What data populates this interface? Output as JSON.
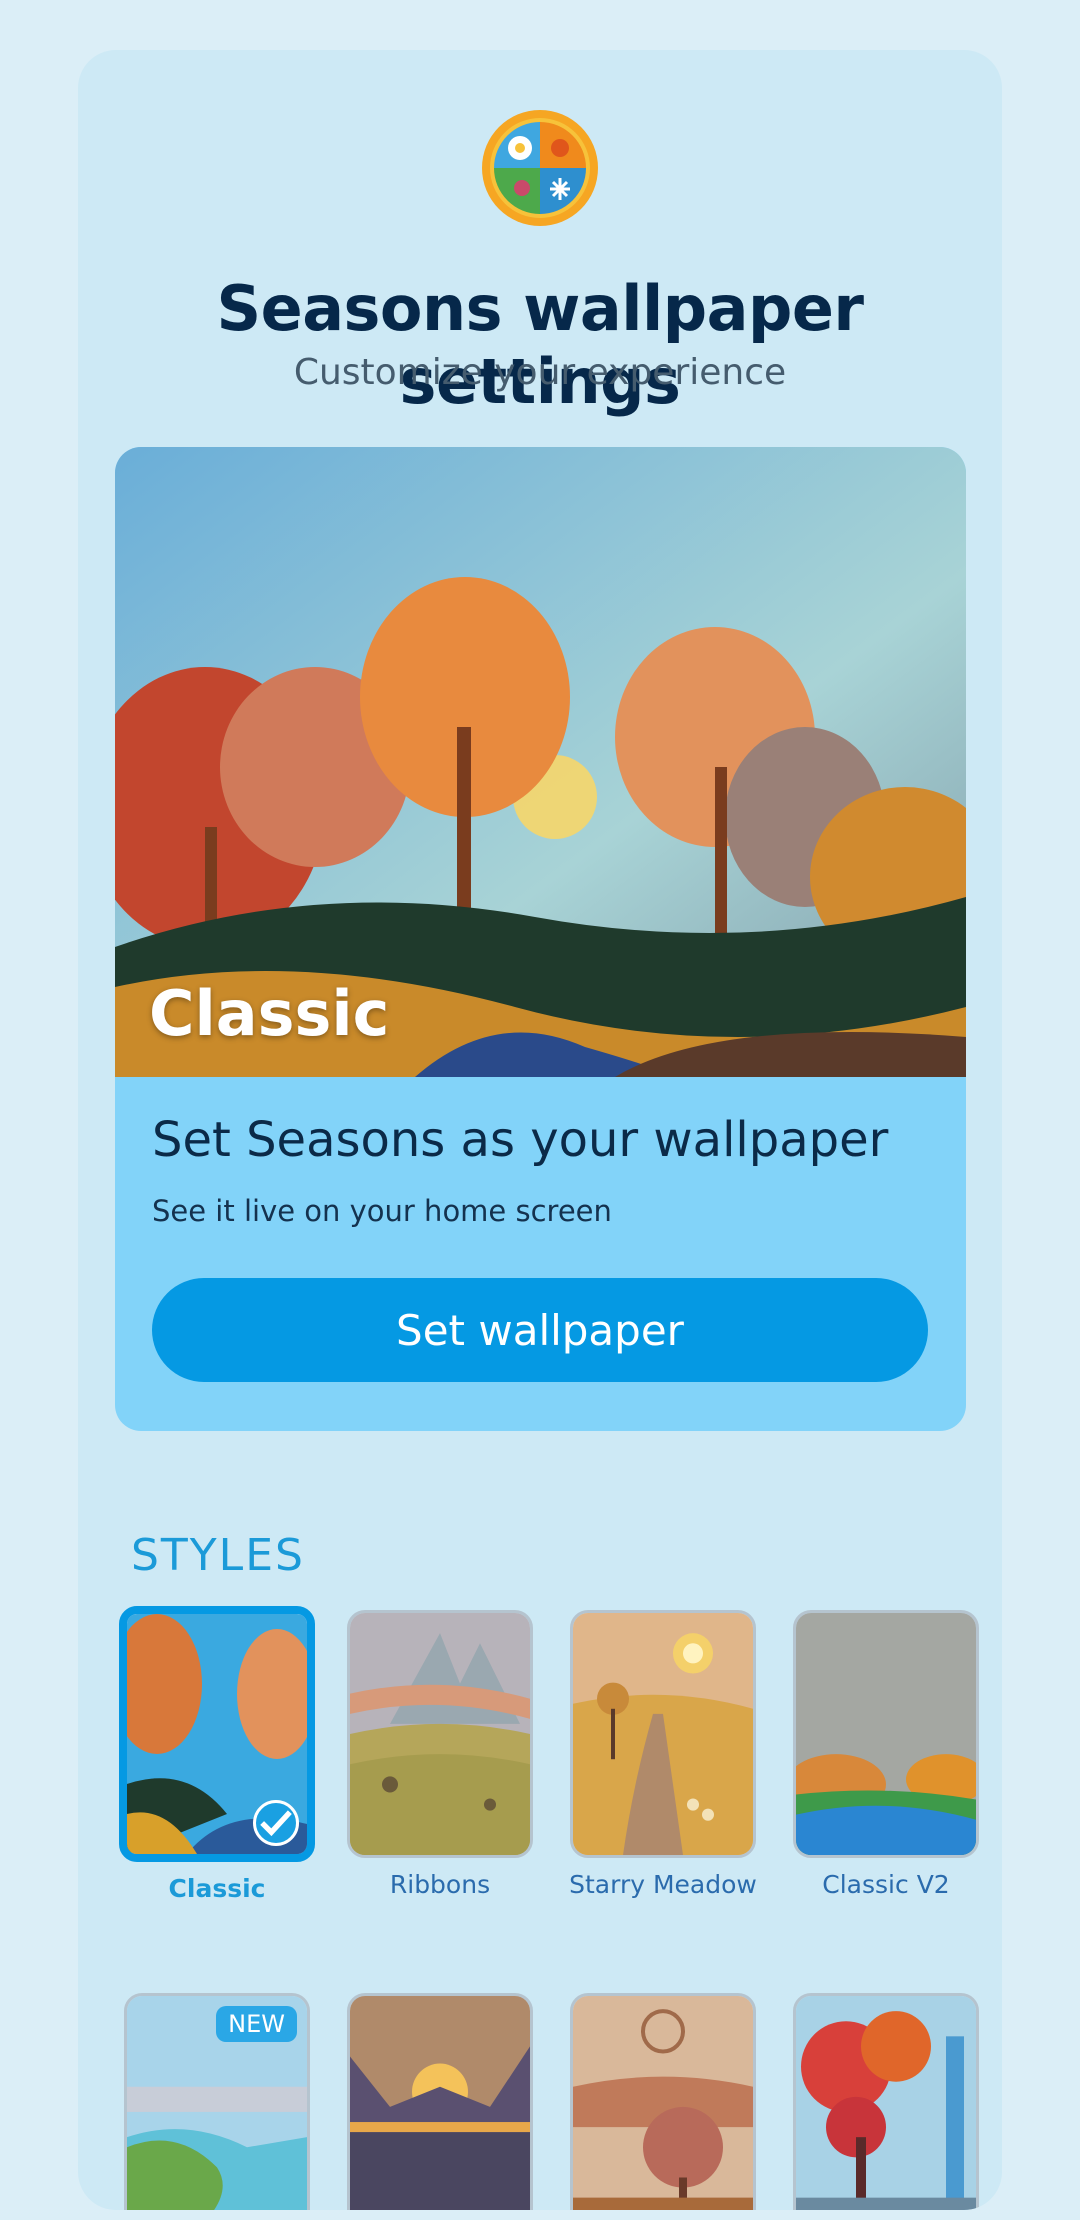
{
  "header": {
    "title": "Seasons wallpaper settings",
    "subtitle": "Customize your experience",
    "logo": "four-seasons-logo"
  },
  "hero": {
    "caption": "Classic",
    "heading": "Set Seasons as your wallpaper",
    "subheading": "See it live on your home screen",
    "button_label": "Set wallpaper"
  },
  "styles": {
    "heading": "STYLES",
    "items": [
      {
        "label": "Classic",
        "selected": true
      },
      {
        "label": "Ribbons",
        "selected": false
      },
      {
        "label": "Starry Meadow",
        "selected": false
      },
      {
        "label": "Classic V2",
        "selected": false
      },
      {
        "label": "",
        "badge": "NEW"
      },
      {
        "label": ""
      },
      {
        "label": ""
      },
      {
        "label": ""
      }
    ]
  },
  "colors": {
    "background": "#dbeef7",
    "panel": "#cde9f5",
    "accent": "#0599e3",
    "card": "#82d3f9"
  }
}
